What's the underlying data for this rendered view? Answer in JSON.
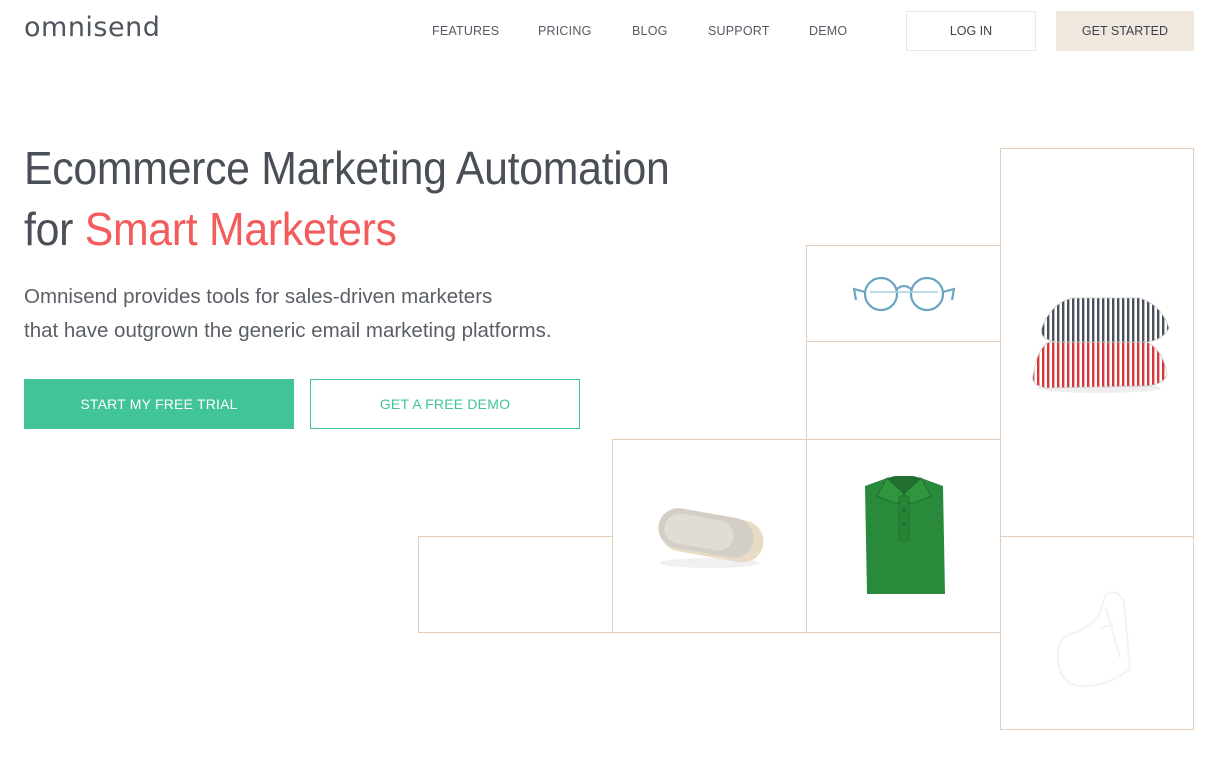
{
  "header": {
    "logo": "omnisend",
    "nav": [
      {
        "label": "FEATURES"
      },
      {
        "label": "PRICING"
      },
      {
        "label": "BLOG"
      },
      {
        "label": "SUPPORT"
      },
      {
        "label": "DEMO"
      }
    ],
    "login_label": "LOG IN",
    "get_started_label": "GET STARTED"
  },
  "hero": {
    "headline_line1": "Ecommerce Marketing Automation",
    "headline_line2_prefix": "for ",
    "headline_line2_accent": "Smart Marketers",
    "subtext_line1": "Omnisend provides tools for sales-driven marketers",
    "subtext_line2": "that have outgrown the generic email marketing platforms.",
    "primary_cta": "START MY FREE TRIAL",
    "secondary_cta": "GET A FREE DEMO"
  },
  "product_grid": {
    "tiles": [
      {
        "product": "striped-pillows"
      },
      {
        "product": "eyeglasses"
      },
      {
        "product": "empty"
      },
      {
        "product": "bluetooth-speaker"
      },
      {
        "product": "green-polo-shirt"
      },
      {
        "product": "empty"
      },
      {
        "product": "sneaker-faded"
      }
    ]
  },
  "colors": {
    "brand_green": "#41c497",
    "accent_red": "#f25c5c",
    "tile_border": "#e3cdb9",
    "get_started_bg": "#f0e7de",
    "text_dark": "#4a4f57"
  }
}
